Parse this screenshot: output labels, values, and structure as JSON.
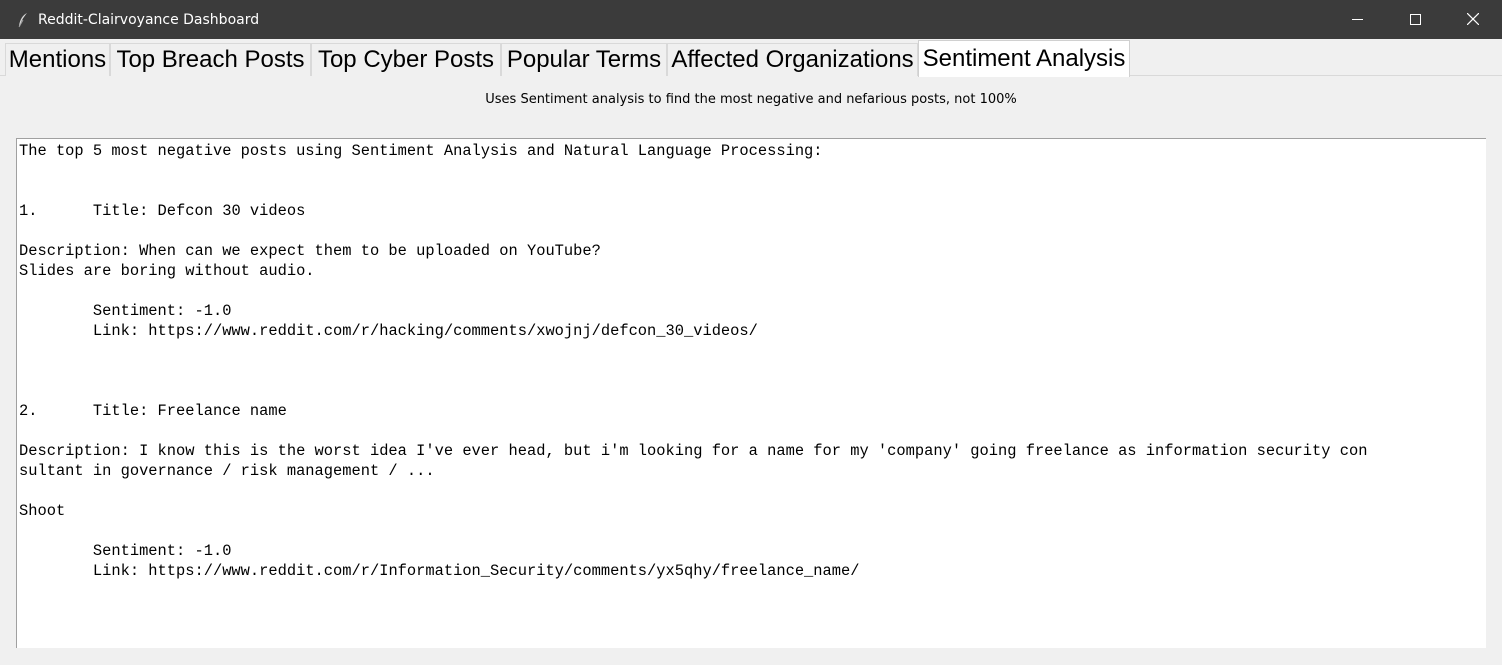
{
  "window": {
    "title": "Reddit-Clairvoyance Dashboard",
    "icon": "feather-icon",
    "controls": [
      "minimize-icon",
      "maximize-icon",
      "close-icon"
    ]
  },
  "tabs": [
    {
      "label": "Mentions"
    },
    {
      "label": "Top Breach Posts"
    },
    {
      "label": "Top Cyber Posts"
    },
    {
      "label": "Popular Terms"
    },
    {
      "label": "Affected Organizations"
    },
    {
      "label": "Sentiment Analysis",
      "selected": true
    }
  ],
  "caption": "Uses Sentiment analysis to find the most negative and nefarious posts, not 100%",
  "output": {
    "header": "The top 5 most negative posts using Sentiment Analysis and Natural Language Processing:",
    "posts": [
      {
        "index": "1.",
        "title_line": "Title: Defcon 30 videos",
        "desc_line1": "Description: When can we expect them to be uploaded on YouTube?",
        "desc_line2": "Slides are boring without audio.",
        "sentiment_line": "Sentiment: -1.0",
        "link_line": "Link: https://www.reddit.com/r/hacking/comments/xwojnj/defcon_30_videos/"
      },
      {
        "index": "2.",
        "title_line": "Title: Freelance name",
        "desc_line1": "Description: I know this is the worst idea I've ever head, but i'm looking for a name for my 'company' going freelance as information security con",
        "desc_line2": "sultant in governance / risk management / ...",
        "desc_line3": "Shoot",
        "sentiment_line": "Sentiment: -1.0",
        "link_line": "Link: https://www.reddit.com/r/Information_Security/comments/yx5qhy/freelance_name/"
      }
    ]
  }
}
